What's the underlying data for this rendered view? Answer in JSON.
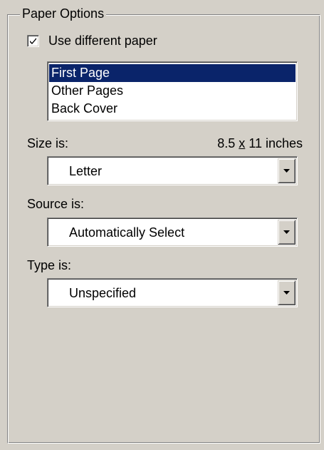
{
  "group": {
    "title": "Paper Options"
  },
  "use_different_paper": {
    "label": "Use different paper",
    "checked": true
  },
  "pages_list": {
    "items": [
      "First Page",
      "Other Pages",
      "Back Cover"
    ],
    "selected": "First Page"
  },
  "size": {
    "label": "Size is:",
    "width": "8.5",
    "x": "x",
    "height_unit": "11 inches",
    "value": "Letter"
  },
  "source": {
    "label": "Source is:",
    "value": "Automatically Select"
  },
  "type": {
    "label": "Type is:",
    "value": "Unspecified"
  },
  "colors": {
    "face": "#d4d0c8",
    "selection": "#0a246a"
  }
}
